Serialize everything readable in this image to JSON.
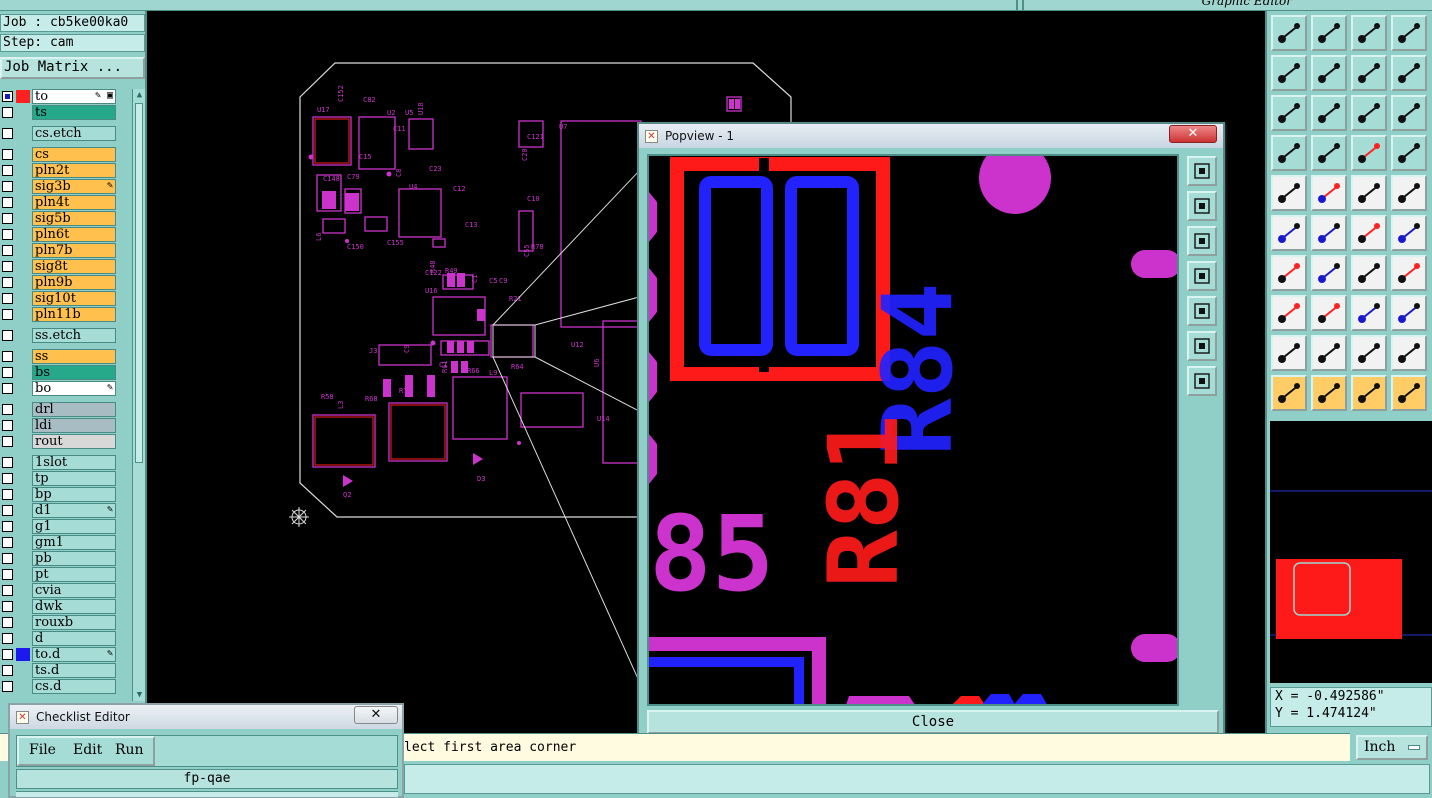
{
  "app": {
    "window_title": "Graphic Editor"
  },
  "job": {
    "job_label": "Job : cb5ke00ka0",
    "step_label": "Step: cam",
    "job_matrix_button": "Job Matrix ..."
  },
  "layers": [
    {
      "name": "to",
      "color": "#ffffff",
      "checked": true,
      "swatch": "#ff2020",
      "mark": "✎ ▣"
    },
    {
      "name": "ts",
      "color": "#26a88a",
      "checked": false,
      "swatch": "",
      "mark": ""
    },
    {
      "name": "cs.etch",
      "color": "#a6dcd6",
      "checked": false,
      "swatch": "",
      "mark": ""
    },
    {
      "name": "cs",
      "color": "#ffc04d",
      "checked": false,
      "swatch": "",
      "mark": ""
    },
    {
      "name": "pln2t",
      "color": "#ffc04d",
      "checked": false,
      "swatch": "",
      "mark": ""
    },
    {
      "name": "sig3b",
      "color": "#ffc04d",
      "checked": false,
      "swatch": "",
      "mark": "✎"
    },
    {
      "name": "pln4t",
      "color": "#ffc04d",
      "checked": false,
      "swatch": "",
      "mark": ""
    },
    {
      "name": "sig5b",
      "color": "#ffc04d",
      "checked": false,
      "swatch": "",
      "mark": ""
    },
    {
      "name": "pln6t",
      "color": "#ffc04d",
      "checked": false,
      "swatch": "",
      "mark": ""
    },
    {
      "name": "pln7b",
      "color": "#ffc04d",
      "checked": false,
      "swatch": "",
      "mark": ""
    },
    {
      "name": "sig8t",
      "color": "#ffc04d",
      "checked": false,
      "swatch": "",
      "mark": ""
    },
    {
      "name": "pln9b",
      "color": "#ffc04d",
      "checked": false,
      "swatch": "",
      "mark": ""
    },
    {
      "name": "sig10t",
      "color": "#ffc04d",
      "checked": false,
      "swatch": "",
      "mark": ""
    },
    {
      "name": "pln11b",
      "color": "#ffc04d",
      "checked": false,
      "swatch": "",
      "mark": ""
    },
    {
      "name": "ss.etch",
      "color": "#a6dcd6",
      "checked": false,
      "swatch": "",
      "mark": ""
    },
    {
      "name": "ss",
      "color": "#ffc04d",
      "checked": false,
      "swatch": "",
      "mark": ""
    },
    {
      "name": "bs",
      "color": "#26a88a",
      "checked": false,
      "swatch": "",
      "mark": ""
    },
    {
      "name": "bo",
      "color": "#ffffff",
      "checked": false,
      "swatch": "",
      "mark": "✎"
    },
    {
      "name": "drl",
      "color": "#a8bcc4",
      "checked": false,
      "swatch": "",
      "mark": ""
    },
    {
      "name": "ldi",
      "color": "#a8bcc4",
      "checked": false,
      "swatch": "",
      "mark": ""
    },
    {
      "name": "rout",
      "color": "#d8d8d8",
      "checked": false,
      "swatch": "",
      "mark": ""
    },
    {
      "name": "1slot",
      "color": "#a6dcd6",
      "checked": false,
      "swatch": "",
      "mark": ""
    },
    {
      "name": "tp",
      "color": "#a6dcd6",
      "checked": false,
      "swatch": "",
      "mark": ""
    },
    {
      "name": "bp",
      "color": "#a6dcd6",
      "checked": false,
      "swatch": "",
      "mark": ""
    },
    {
      "name": "d1",
      "color": "#a6dcd6",
      "checked": false,
      "swatch": "",
      "mark": "✎"
    },
    {
      "name": "g1",
      "color": "#a6dcd6",
      "checked": false,
      "swatch": "",
      "mark": ""
    },
    {
      "name": "gm1",
      "color": "#a6dcd6",
      "checked": false,
      "swatch": "",
      "mark": ""
    },
    {
      "name": "pb",
      "color": "#a6dcd6",
      "checked": false,
      "swatch": "",
      "mark": ""
    },
    {
      "name": "pt",
      "color": "#a6dcd6",
      "checked": false,
      "swatch": "",
      "mark": ""
    },
    {
      "name": "cvia",
      "color": "#a6dcd6",
      "checked": false,
      "swatch": "",
      "mark": ""
    },
    {
      "name": "dwk",
      "color": "#a6dcd6",
      "checked": false,
      "swatch": "",
      "mark": ""
    },
    {
      "name": "rouxb",
      "color": "#a6dcd6",
      "checked": false,
      "swatch": "",
      "mark": ""
    },
    {
      "name": "d",
      "color": "#a6dcd6",
      "checked": false,
      "swatch": "",
      "mark": ""
    },
    {
      "name": "to.d",
      "color": "#a6dcd6",
      "checked": false,
      "swatch": "#1a1aee",
      "mark": "✎"
    },
    {
      "name": "ts.d",
      "color": "#a6dcd6",
      "checked": false,
      "swatch": "",
      "mark": ""
    },
    {
      "name": "cs.d",
      "color": "#a6dcd6",
      "checked": false,
      "swatch": "",
      "mark": ""
    }
  ],
  "popview": {
    "title": "Popview - 1",
    "close_x": "✕",
    "close_button": "Close",
    "silkscreen_labels": [
      "R84",
      "R81",
      "85"
    ]
  },
  "board": {
    "labels": [
      "U17",
      "C152",
      "C82",
      "U2",
      "U5",
      "U18",
      "C11",
      "C121",
      "U7",
      "C20",
      "C15",
      "C148",
      "C79",
      "C8",
      "U4",
      "C12",
      "C10",
      "L6",
      "C150",
      "C155",
      "C122",
      "R48",
      "R49",
      "C13",
      "U16",
      "C1",
      "C5",
      "C9",
      "R21",
      "C55",
      "U12",
      "J3",
      "C1",
      "R61",
      "R66",
      "L9",
      "R64",
      "U6",
      "R58",
      "R68",
      "R71",
      "L3",
      "D3",
      "Q2",
      "U14",
      "C9",
      "R78",
      "C23"
    ]
  },
  "checklist": {
    "title": "Checklist Editor",
    "close_x": "✕",
    "menu": [
      "File",
      "Edit",
      "Run"
    ],
    "job_name": "fp-qae"
  },
  "prompt": {
    "text": "lect first area corner"
  },
  "units": {
    "label": "Inch"
  },
  "coords": {
    "x": "X = -0.492586\"",
    "y": "Y = 1.474124\""
  },
  "toolbar": {
    "tools": [
      "zoom-home",
      "zoom-back",
      "home",
      "frame",
      "pan-left",
      "pan-right",
      "reverse",
      "flip",
      "zoom-fit",
      "center",
      "scale-1-2",
      "help",
      "properties",
      "grid",
      "measure-red",
      "measure-pair",
      "dot-select",
      "red-arrow",
      "ruler",
      "snap",
      "connect",
      "cross",
      "route-red",
      "route-blue",
      "angle",
      "line-diag",
      "undo-arc",
      "flip-f",
      "snap-square",
      "line-red",
      "move",
      "box",
      "triangle-a",
      "arrow-a",
      "arrow-up",
      "arrow-ro",
      "pointer",
      "pointer-box",
      "pointer-orange",
      "pointer-tree"
    ]
  },
  "colors": {
    "teal": "#8fcfc8",
    "canvas": "#000000",
    "magenta": "#cc33cc",
    "red": "#ff1a1a",
    "blue": "#2222ff",
    "orange": "#ffc04d"
  }
}
